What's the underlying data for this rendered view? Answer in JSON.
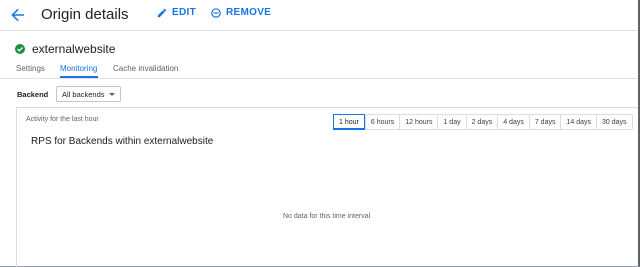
{
  "header": {
    "title": "Origin details",
    "edit_label": "EDIT",
    "remove_label": "REMOVE"
  },
  "origin": {
    "name": "externalwebsite",
    "status_color": "#1e8e3e"
  },
  "tabs": [
    {
      "label": "Settings"
    },
    {
      "label": "Monitoring",
      "active": true
    },
    {
      "label": "Cache invalidation"
    }
  ],
  "backend": {
    "label": "Backend",
    "selected": "All backends"
  },
  "panel": {
    "activity_label": "Activity for the last hour",
    "time_ranges": [
      "1 hour",
      "6 hours",
      "12 hours",
      "1 day",
      "2 days",
      "4 days",
      "7 days",
      "14 days",
      "30 days"
    ],
    "selected_range": "1 hour",
    "chart_title": "RPS for Backends within externalwebsite",
    "empty_message": "No data for this time interval"
  },
  "colors": {
    "accent": "#1a73e8",
    "success": "#1e8e3e"
  }
}
